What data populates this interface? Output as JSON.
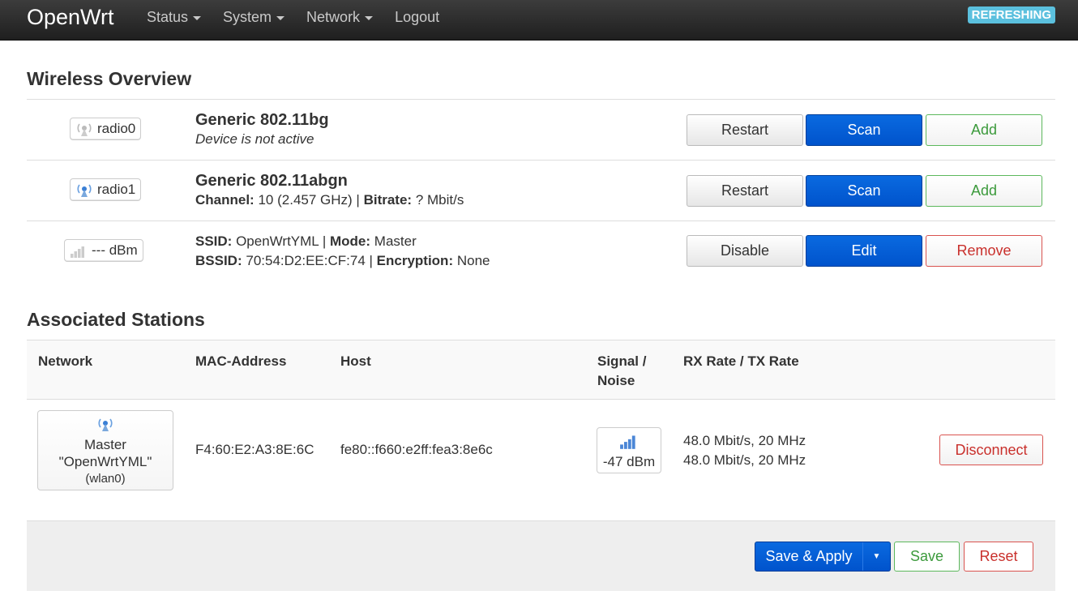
{
  "navbar": {
    "brand": "OpenWrt",
    "menu": [
      {
        "label": "Status",
        "dropdown": true
      },
      {
        "label": "System",
        "dropdown": true
      },
      {
        "label": "Network",
        "dropdown": true
      },
      {
        "label": "Logout",
        "dropdown": false
      }
    ],
    "badge": "REFRESHING"
  },
  "wireless": {
    "title": "Wireless Overview",
    "rows": [
      {
        "chip": "radio0",
        "device": "Generic 802.11bg",
        "status": "Device is not active",
        "buttons": [
          "Restart",
          "Scan",
          "Add"
        ]
      },
      {
        "chip": "radio1",
        "device": "Generic 802.11abgn",
        "channel_label": "Channel:",
        "channel_value": "10 (2.457 GHz)",
        "bitrate_label": "Bitrate:",
        "bitrate_value": "? Mbit/s",
        "buttons": [
          "Restart",
          "Scan",
          "Add"
        ]
      },
      {
        "chip": "--- dBm",
        "ssid_label": "SSID:",
        "ssid_value": "OpenWrtYML",
        "mode_label": "Mode:",
        "mode_value": "Master",
        "bssid_label": "BSSID:",
        "bssid_value": "70:54:D2:EE:CF:74",
        "enc_label": "Encryption:",
        "enc_value": "None",
        "buttons": [
          "Disable",
          "Edit",
          "Remove"
        ]
      }
    ],
    "separator": " | "
  },
  "stations": {
    "title": "Associated Stations",
    "headers": {
      "network": "Network",
      "mac": "MAC-Address",
      "host": "Host",
      "signal_line1": "Signal /",
      "signal_line2": "Noise",
      "rate": "RX Rate / TX Rate"
    },
    "row": {
      "network_mode": "Master",
      "network_ssid": "\"OpenWrtYML\"",
      "network_iface": "(wlan0)",
      "mac": "F4:60:E2:A3:8E:6C",
      "host": "fe80::f660:e2ff:fea3:8e6c",
      "signal": "-47 dBm",
      "rx_rate": "48.0 Mbit/s, 20 MHz",
      "tx_rate": "48.0 Mbit/s, 20 MHz",
      "disconnect": "Disconnect"
    }
  },
  "footer": {
    "save_apply": "Save & Apply",
    "save": "Save",
    "reset": "Reset"
  },
  "colors": {
    "primary": "#0053cc",
    "success": "#5cb85c",
    "danger": "#d9534f",
    "badge": "#5bc0de"
  }
}
